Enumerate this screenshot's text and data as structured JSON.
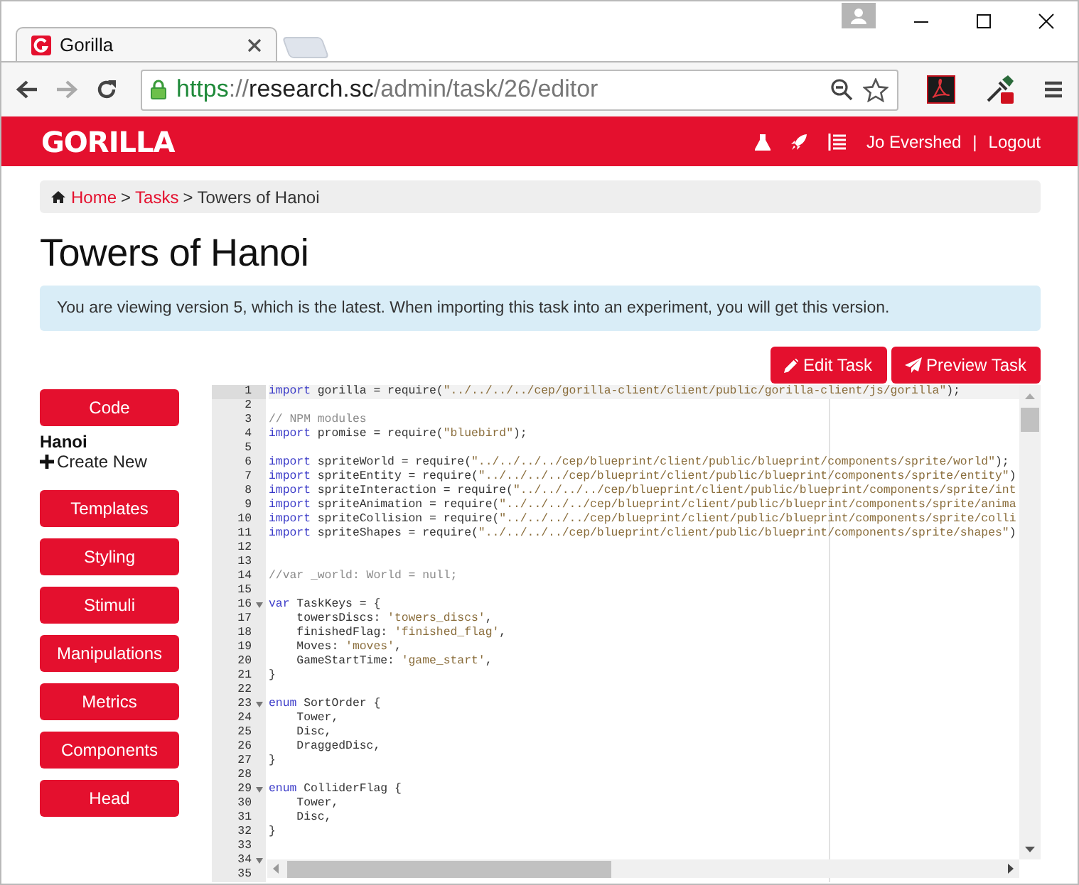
{
  "browser": {
    "tab": {
      "title": "Gorilla",
      "selected": true
    },
    "url": {
      "scheme": "https",
      "separator": "://",
      "host": "research.sc",
      "path": "/admin/task/26/editor"
    },
    "forward_disabled": true
  },
  "navbar": {
    "logo": "GORILLA",
    "user": "Jo Evershed",
    "separator": "|",
    "logout": "Logout"
  },
  "breadcrumb": [
    {
      "label": "Home",
      "link": true
    },
    {
      "label": ">",
      "link": false
    },
    {
      "label": "Tasks",
      "link": true
    },
    {
      "label": ">",
      "link": false
    },
    {
      "label": "Towers of Hanoi",
      "link": false
    }
  ],
  "title": "Towers of Hanoi",
  "alert": "You are viewing version 5, which is the latest. When importing this task into an experiment, you will get this version.",
  "actions": [
    {
      "label": "Edit Task",
      "kind": "edit"
    },
    {
      "label": "Preview Task",
      "kind": "preview"
    }
  ],
  "sidebar": [
    {
      "kind": "button",
      "label": "Code"
    },
    {
      "kind": "file",
      "label": "Hanoi"
    },
    {
      "kind": "create",
      "label": "Create New"
    },
    {
      "kind": "button",
      "label": "Templates"
    },
    {
      "kind": "button",
      "label": "Styling"
    },
    {
      "kind": "button",
      "label": "Stimuli"
    },
    {
      "kind": "button",
      "label": "Manipulations"
    },
    {
      "kind": "button",
      "label": "Metrics"
    },
    {
      "kind": "button",
      "label": "Components"
    },
    {
      "kind": "button",
      "label": "Head"
    }
  ],
  "editor": {
    "lines": [
      {
        "number": "1",
        "active": true,
        "foldable": false,
        "tokens": [
          {
            "kind": "keyword",
            "text": "import"
          },
          {
            "kind": "plain",
            "text": " gorilla = require("
          },
          {
            "kind": "string",
            "text": "\"../../../../cep/gorilla-client/client/public/gorilla-client/js/gorilla\""
          },
          {
            "kind": "plain",
            "text": ");"
          }
        ]
      },
      {
        "number": "2",
        "active": false,
        "foldable": false
      },
      {
        "number": "3",
        "active": false,
        "foldable": false,
        "tokens": [
          {
            "kind": "comment",
            "text": "// NPM modules"
          }
        ]
      },
      {
        "number": "4",
        "active": false,
        "foldable": false,
        "tokens": [
          {
            "kind": "keyword",
            "text": "import"
          },
          {
            "kind": "plain",
            "text": " promise = require("
          },
          {
            "kind": "string",
            "text": "\"bluebird\""
          },
          {
            "kind": "plain",
            "text": ");"
          }
        ]
      },
      {
        "number": "5",
        "active": false,
        "foldable": false
      },
      {
        "number": "6",
        "active": false,
        "foldable": false,
        "tokens": [
          {
            "kind": "keyword",
            "text": "import"
          },
          {
            "kind": "plain",
            "text": " spriteWorld = require("
          },
          {
            "kind": "string",
            "text": "\"../../../../cep/blueprint/client/public/blueprint/components/sprite/world\""
          },
          {
            "kind": "plain",
            "text": ");"
          }
        ]
      },
      {
        "number": "7",
        "active": false,
        "foldable": false,
        "tokens": [
          {
            "kind": "keyword",
            "text": "import"
          },
          {
            "kind": "plain",
            "text": " spriteEntity = require("
          },
          {
            "kind": "string",
            "text": "\"../../../../cep/blueprint/client/public/blueprint/components/sprite/entity\""
          },
          {
            "kind": "plain",
            "text": ")"
          }
        ]
      },
      {
        "number": "8",
        "active": false,
        "foldable": false,
        "tokens": [
          {
            "kind": "keyword",
            "text": "import"
          },
          {
            "kind": "plain",
            "text": " spriteInteraction = require("
          },
          {
            "kind": "string",
            "text": "\"../../../../cep/blueprint/client/public/blueprint/components/sprite/int"
          }
        ]
      },
      {
        "number": "9",
        "active": false,
        "foldable": false,
        "tokens": [
          {
            "kind": "keyword",
            "text": "import"
          },
          {
            "kind": "plain",
            "text": " spriteAnimation = require("
          },
          {
            "kind": "string",
            "text": "\"../../../../cep/blueprint/client/public/blueprint/components/sprite/anima"
          }
        ]
      },
      {
        "number": "10",
        "active": false,
        "foldable": false,
        "tokens": [
          {
            "kind": "keyword",
            "text": "import"
          },
          {
            "kind": "plain",
            "text": " spriteCollision = require("
          },
          {
            "kind": "string",
            "text": "\"../../../../cep/blueprint/client/public/blueprint/components/sprite/colli"
          }
        ]
      },
      {
        "number": "11",
        "active": false,
        "foldable": false,
        "tokens": [
          {
            "kind": "keyword",
            "text": "import"
          },
          {
            "kind": "plain",
            "text": " spriteShapes = require("
          },
          {
            "kind": "string",
            "text": "\"../../../../cep/blueprint/client/public/blueprint/components/sprite/shapes\""
          },
          {
            "kind": "plain",
            "text": ")"
          }
        ]
      },
      {
        "number": "12",
        "active": false,
        "foldable": false
      },
      {
        "number": "13",
        "active": false,
        "foldable": false
      },
      {
        "number": "14",
        "active": false,
        "foldable": false,
        "tokens": [
          {
            "kind": "comment",
            "text": "//var _world: World = null;"
          }
        ]
      },
      {
        "number": "15",
        "active": false,
        "foldable": false
      },
      {
        "number": "16",
        "active": false,
        "foldable": true,
        "tokens": [
          {
            "kind": "keyword",
            "text": "var"
          },
          {
            "kind": "plain",
            "text": " TaskKeys = {"
          }
        ]
      },
      {
        "number": "17",
        "active": false,
        "foldable": false,
        "tokens": [
          {
            "kind": "plain",
            "text": "    towersDiscs: "
          },
          {
            "kind": "string",
            "text": "'towers_discs'"
          },
          {
            "kind": "plain",
            "text": ","
          }
        ]
      },
      {
        "number": "18",
        "active": false,
        "foldable": false,
        "tokens": [
          {
            "kind": "plain",
            "text": "    finishedFlag: "
          },
          {
            "kind": "string",
            "text": "'finished_flag'"
          },
          {
            "kind": "plain",
            "text": ","
          }
        ]
      },
      {
        "number": "19",
        "active": false,
        "foldable": false,
        "tokens": [
          {
            "kind": "plain",
            "text": "    Moves: "
          },
          {
            "kind": "string",
            "text": "'moves'"
          },
          {
            "kind": "plain",
            "text": ","
          }
        ]
      },
      {
        "number": "20",
        "active": false,
        "foldable": false,
        "tokens": [
          {
            "kind": "plain",
            "text": "    GameStartTime: "
          },
          {
            "kind": "string",
            "text": "'game_start'"
          },
          {
            "kind": "plain",
            "text": ","
          }
        ]
      },
      {
        "number": "21",
        "active": false,
        "foldable": false,
        "tokens": [
          {
            "kind": "plain",
            "text": "}"
          }
        ]
      },
      {
        "number": "22",
        "active": false,
        "foldable": false
      },
      {
        "number": "23",
        "active": false,
        "foldable": true,
        "tokens": [
          {
            "kind": "keyword",
            "text": "enum"
          },
          {
            "kind": "plain",
            "text": " SortOrder {"
          }
        ]
      },
      {
        "number": "24",
        "active": false,
        "foldable": false,
        "tokens": [
          {
            "kind": "plain",
            "text": "    Tower,"
          }
        ]
      },
      {
        "number": "25",
        "active": false,
        "foldable": false,
        "tokens": [
          {
            "kind": "plain",
            "text": "    Disc,"
          }
        ]
      },
      {
        "number": "26",
        "active": false,
        "foldable": false,
        "tokens": [
          {
            "kind": "plain",
            "text": "    DraggedDisc,"
          }
        ]
      },
      {
        "number": "27",
        "active": false,
        "foldable": false,
        "tokens": [
          {
            "kind": "plain",
            "text": "}"
          }
        ]
      },
      {
        "number": "28",
        "active": false,
        "foldable": false
      },
      {
        "number": "29",
        "active": false,
        "foldable": true,
        "tokens": [
          {
            "kind": "keyword",
            "text": "enum"
          },
          {
            "kind": "plain",
            "text": " ColliderFlag {"
          }
        ]
      },
      {
        "number": "30",
        "active": false,
        "foldable": false,
        "tokens": [
          {
            "kind": "plain",
            "text": "    Tower,"
          }
        ]
      },
      {
        "number": "31",
        "active": false,
        "foldable": false,
        "tokens": [
          {
            "kind": "plain",
            "text": "    Disc,"
          }
        ]
      },
      {
        "number": "32",
        "active": false,
        "foldable": false,
        "tokens": [
          {
            "kind": "plain",
            "text": "}"
          }
        ]
      },
      {
        "number": "33",
        "active": false,
        "foldable": false
      },
      {
        "number": "34",
        "active": false,
        "foldable": true
      },
      {
        "number": "35",
        "active": false,
        "foldable": false
      }
    ]
  }
}
